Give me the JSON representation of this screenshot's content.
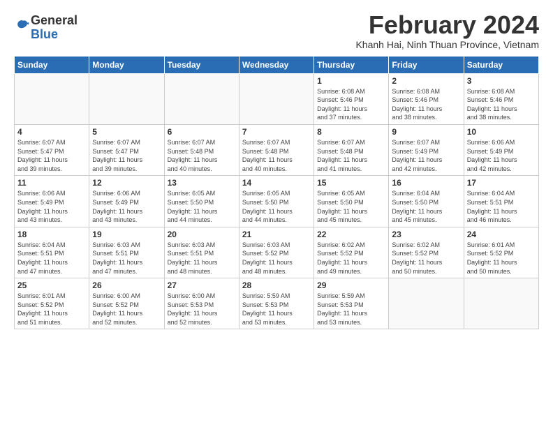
{
  "logo": {
    "general": "General",
    "blue": "Blue"
  },
  "header": {
    "month_title": "February 2024",
    "subtitle": "Khanh Hai, Ninh Thuan Province, Vietnam"
  },
  "columns": [
    "Sunday",
    "Monday",
    "Tuesday",
    "Wednesday",
    "Thursday",
    "Friday",
    "Saturday"
  ],
  "weeks": [
    [
      {
        "day": "",
        "info": ""
      },
      {
        "day": "",
        "info": ""
      },
      {
        "day": "",
        "info": ""
      },
      {
        "day": "",
        "info": ""
      },
      {
        "day": "1",
        "info": "Sunrise: 6:08 AM\nSunset: 5:46 PM\nDaylight: 11 hours\nand 37 minutes."
      },
      {
        "day": "2",
        "info": "Sunrise: 6:08 AM\nSunset: 5:46 PM\nDaylight: 11 hours\nand 38 minutes."
      },
      {
        "day": "3",
        "info": "Sunrise: 6:08 AM\nSunset: 5:46 PM\nDaylight: 11 hours\nand 38 minutes."
      }
    ],
    [
      {
        "day": "4",
        "info": "Sunrise: 6:07 AM\nSunset: 5:47 PM\nDaylight: 11 hours\nand 39 minutes."
      },
      {
        "day": "5",
        "info": "Sunrise: 6:07 AM\nSunset: 5:47 PM\nDaylight: 11 hours\nand 39 minutes."
      },
      {
        "day": "6",
        "info": "Sunrise: 6:07 AM\nSunset: 5:48 PM\nDaylight: 11 hours\nand 40 minutes."
      },
      {
        "day": "7",
        "info": "Sunrise: 6:07 AM\nSunset: 5:48 PM\nDaylight: 11 hours\nand 40 minutes."
      },
      {
        "day": "8",
        "info": "Sunrise: 6:07 AM\nSunset: 5:48 PM\nDaylight: 11 hours\nand 41 minutes."
      },
      {
        "day": "9",
        "info": "Sunrise: 6:07 AM\nSunset: 5:49 PM\nDaylight: 11 hours\nand 42 minutes."
      },
      {
        "day": "10",
        "info": "Sunrise: 6:06 AM\nSunset: 5:49 PM\nDaylight: 11 hours\nand 42 minutes."
      }
    ],
    [
      {
        "day": "11",
        "info": "Sunrise: 6:06 AM\nSunset: 5:49 PM\nDaylight: 11 hours\nand 43 minutes."
      },
      {
        "day": "12",
        "info": "Sunrise: 6:06 AM\nSunset: 5:49 PM\nDaylight: 11 hours\nand 43 minutes."
      },
      {
        "day": "13",
        "info": "Sunrise: 6:05 AM\nSunset: 5:50 PM\nDaylight: 11 hours\nand 44 minutes."
      },
      {
        "day": "14",
        "info": "Sunrise: 6:05 AM\nSunset: 5:50 PM\nDaylight: 11 hours\nand 44 minutes."
      },
      {
        "day": "15",
        "info": "Sunrise: 6:05 AM\nSunset: 5:50 PM\nDaylight: 11 hours\nand 45 minutes."
      },
      {
        "day": "16",
        "info": "Sunrise: 6:04 AM\nSunset: 5:50 PM\nDaylight: 11 hours\nand 45 minutes."
      },
      {
        "day": "17",
        "info": "Sunrise: 6:04 AM\nSunset: 5:51 PM\nDaylight: 11 hours\nand 46 minutes."
      }
    ],
    [
      {
        "day": "18",
        "info": "Sunrise: 6:04 AM\nSunset: 5:51 PM\nDaylight: 11 hours\nand 47 minutes."
      },
      {
        "day": "19",
        "info": "Sunrise: 6:03 AM\nSunset: 5:51 PM\nDaylight: 11 hours\nand 47 minutes."
      },
      {
        "day": "20",
        "info": "Sunrise: 6:03 AM\nSunset: 5:51 PM\nDaylight: 11 hours\nand 48 minutes."
      },
      {
        "day": "21",
        "info": "Sunrise: 6:03 AM\nSunset: 5:52 PM\nDaylight: 11 hours\nand 48 minutes."
      },
      {
        "day": "22",
        "info": "Sunrise: 6:02 AM\nSunset: 5:52 PM\nDaylight: 11 hours\nand 49 minutes."
      },
      {
        "day": "23",
        "info": "Sunrise: 6:02 AM\nSunset: 5:52 PM\nDaylight: 11 hours\nand 50 minutes."
      },
      {
        "day": "24",
        "info": "Sunrise: 6:01 AM\nSunset: 5:52 PM\nDaylight: 11 hours\nand 50 minutes."
      }
    ],
    [
      {
        "day": "25",
        "info": "Sunrise: 6:01 AM\nSunset: 5:52 PM\nDaylight: 11 hours\nand 51 minutes."
      },
      {
        "day": "26",
        "info": "Sunrise: 6:00 AM\nSunset: 5:52 PM\nDaylight: 11 hours\nand 52 minutes."
      },
      {
        "day": "27",
        "info": "Sunrise: 6:00 AM\nSunset: 5:53 PM\nDaylight: 11 hours\nand 52 minutes."
      },
      {
        "day": "28",
        "info": "Sunrise: 5:59 AM\nSunset: 5:53 PM\nDaylight: 11 hours\nand 53 minutes."
      },
      {
        "day": "29",
        "info": "Sunrise: 5:59 AM\nSunset: 5:53 PM\nDaylight: 11 hours\nand 53 minutes."
      },
      {
        "day": "",
        "info": ""
      },
      {
        "day": "",
        "info": ""
      }
    ]
  ]
}
